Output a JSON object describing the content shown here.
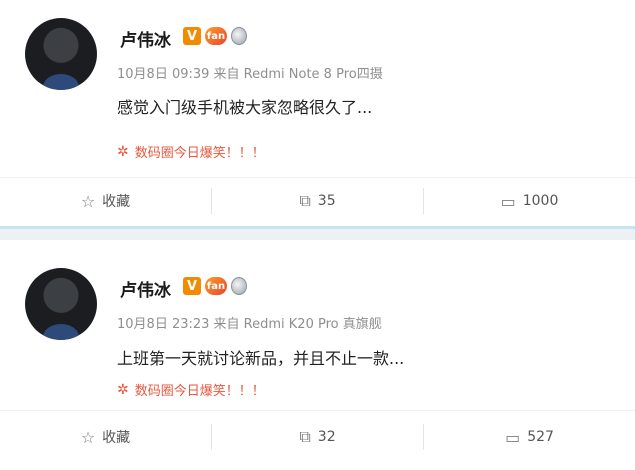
{
  "posts": [
    {
      "author": "卢伟冰",
      "badge_v": "V",
      "fan_badge": "fan",
      "meta": "10月8日 09:39 来自 Redmi Note 8 Pro四摄",
      "text": "感觉入门级手机被大家忽略很久了...",
      "topic_icon": "flower-icon",
      "topic": "数码圈今日爆笑！！！",
      "actions": {
        "favorite": "收藏",
        "repost": "35",
        "comment": "1000"
      }
    },
    {
      "author": "卢伟冰",
      "badge_v": "V",
      "fan_badge": "fan",
      "meta": "10月8日 23:23 来自 Redmi K20 Pro 真旗舰",
      "text": "上班第一天就讨论新品，并且不止一款...",
      "topic_icon": "flower-icon",
      "topic": "数码圈今日爆笑！！！",
      "actions": {
        "favorite": "收藏",
        "repost": "32",
        "comment": "527"
      }
    }
  ],
  "icons": {
    "favorite": "star-outline-icon",
    "repost": "share-arrow-icon",
    "comment": "comment-bubble-icon"
  },
  "colors": {
    "link": "#e8573d",
    "badge_v": "#f28b00",
    "divider": "#c8e4f0"
  }
}
